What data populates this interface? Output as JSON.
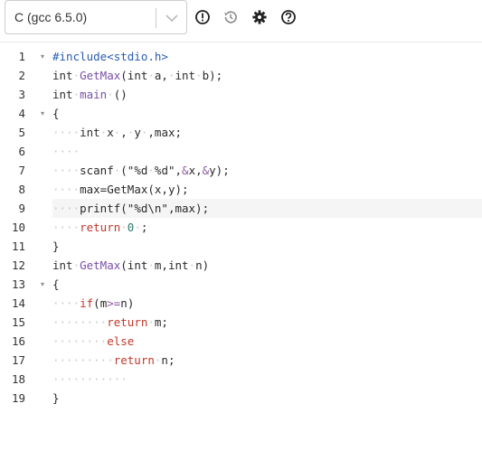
{
  "toolbar": {
    "language_value": "C (gcc 6.5.0)",
    "icons": {
      "info": "exclamation-circle-icon",
      "history": "history-icon",
      "settings": "gear-icon",
      "help": "question-circle-icon"
    }
  },
  "editor": {
    "active_line": 9,
    "lines": [
      {
        "n": "1",
        "fold": "▾",
        "tokens": [
          {
            "t": "#include<stdio.h>",
            "c": "dir"
          }
        ]
      },
      {
        "n": "2",
        "fold": "",
        "tokens": [
          {
            "t": "int",
            "c": "kw"
          },
          {
            "t": "·",
            "c": "ws"
          },
          {
            "t": "GetMax",
            "c": "fn"
          },
          {
            "t": "(int",
            "c": "plain"
          },
          {
            "t": "·",
            "c": "ws"
          },
          {
            "t": "a,",
            "c": "plain"
          },
          {
            "t": "·",
            "c": "ws"
          },
          {
            "t": "int",
            "c": "kw"
          },
          {
            "t": "·",
            "c": "ws"
          },
          {
            "t": "b);",
            "c": "plain"
          }
        ]
      },
      {
        "n": "3",
        "fold": "",
        "tokens": [
          {
            "t": "int",
            "c": "kw"
          },
          {
            "t": "·",
            "c": "ws"
          },
          {
            "t": "main",
            "c": "fn"
          },
          {
            "t": "·",
            "c": "ws"
          },
          {
            "t": "()",
            "c": "plain"
          }
        ]
      },
      {
        "n": "4",
        "fold": "▾",
        "tokens": [
          {
            "t": "{",
            "c": "plain"
          }
        ]
      },
      {
        "n": "5",
        "fold": "",
        "tokens": [
          {
            "t": "····",
            "c": "ws"
          },
          {
            "t": "int",
            "c": "kw"
          },
          {
            "t": "·",
            "c": "ws"
          },
          {
            "t": "x",
            "c": "plain"
          },
          {
            "t": "·",
            "c": "ws"
          },
          {
            "t": ",",
            "c": "plain"
          },
          {
            "t": "·",
            "c": "ws"
          },
          {
            "t": "y",
            "c": "plain"
          },
          {
            "t": "·",
            "c": "ws"
          },
          {
            "t": ",max;",
            "c": "plain"
          }
        ]
      },
      {
        "n": "6",
        "fold": "",
        "tokens": [
          {
            "t": "····",
            "c": "ws"
          }
        ]
      },
      {
        "n": "7",
        "fold": "",
        "tokens": [
          {
            "t": "····",
            "c": "ws"
          },
          {
            "t": "scanf",
            "c": "plain"
          },
          {
            "t": "·",
            "c": "ws"
          },
          {
            "t": "(\"%d",
            "c": "str"
          },
          {
            "t": "·",
            "c": "ws"
          },
          {
            "t": "%d\",",
            "c": "str"
          },
          {
            "t": "&",
            "c": "op"
          },
          {
            "t": "x,",
            "c": "plain"
          },
          {
            "t": "&",
            "c": "op"
          },
          {
            "t": "y);",
            "c": "plain"
          }
        ]
      },
      {
        "n": "8",
        "fold": "",
        "tokens": [
          {
            "t": "····",
            "c": "ws"
          },
          {
            "t": "max=GetMax(x,y);",
            "c": "plain"
          }
        ]
      },
      {
        "n": "9",
        "fold": "",
        "tokens": [
          {
            "t": "····",
            "c": "ws"
          },
          {
            "t": "printf(\"%d\\n\",max);",
            "c": "plain"
          }
        ]
      },
      {
        "n": "10",
        "fold": "",
        "tokens": [
          {
            "t": "····",
            "c": "ws"
          },
          {
            "t": "return",
            "c": "ret"
          },
          {
            "t": "·",
            "c": "ws"
          },
          {
            "t": "0",
            "c": "num"
          },
          {
            "t": "·",
            "c": "ws"
          },
          {
            "t": ";",
            "c": "plain"
          }
        ]
      },
      {
        "n": "11",
        "fold": "",
        "tokens": [
          {
            "t": "}",
            "c": "plain"
          }
        ]
      },
      {
        "n": "12",
        "fold": "",
        "tokens": [
          {
            "t": "int",
            "c": "kw"
          },
          {
            "t": "·",
            "c": "ws"
          },
          {
            "t": "GetMax",
            "c": "fn"
          },
          {
            "t": "(int",
            "c": "plain"
          },
          {
            "t": "·",
            "c": "ws"
          },
          {
            "t": "m,int",
            "c": "plain"
          },
          {
            "t": "·",
            "c": "ws"
          },
          {
            "t": "n)",
            "c": "plain"
          }
        ]
      },
      {
        "n": "13",
        "fold": "▾",
        "tokens": [
          {
            "t": "{",
            "c": "plain"
          }
        ]
      },
      {
        "n": "14",
        "fold": "",
        "tokens": [
          {
            "t": "····",
            "c": "ws"
          },
          {
            "t": "if",
            "c": "ret"
          },
          {
            "t": "(m",
            "c": "plain"
          },
          {
            "t": ">=",
            "c": "op"
          },
          {
            "t": "n)",
            "c": "plain"
          }
        ]
      },
      {
        "n": "15",
        "fold": "",
        "tokens": [
          {
            "t": "········",
            "c": "ws"
          },
          {
            "t": "return",
            "c": "ret"
          },
          {
            "t": "·",
            "c": "ws"
          },
          {
            "t": "m;",
            "c": "plain"
          }
        ]
      },
      {
        "n": "16",
        "fold": "",
        "tokens": [
          {
            "t": "········",
            "c": "ws"
          },
          {
            "t": "else",
            "c": "ret"
          }
        ]
      },
      {
        "n": "17",
        "fold": "",
        "tokens": [
          {
            "t": "·········",
            "c": "ws"
          },
          {
            "t": "return",
            "c": "ret"
          },
          {
            "t": "·",
            "c": "ws"
          },
          {
            "t": "n;",
            "c": "plain"
          }
        ]
      },
      {
        "n": "18",
        "fold": "",
        "tokens": [
          {
            "t": "···········",
            "c": "ws"
          }
        ]
      },
      {
        "n": "19",
        "fold": "",
        "tokens": [
          {
            "t": "}",
            "c": "plain"
          }
        ]
      }
    ]
  }
}
